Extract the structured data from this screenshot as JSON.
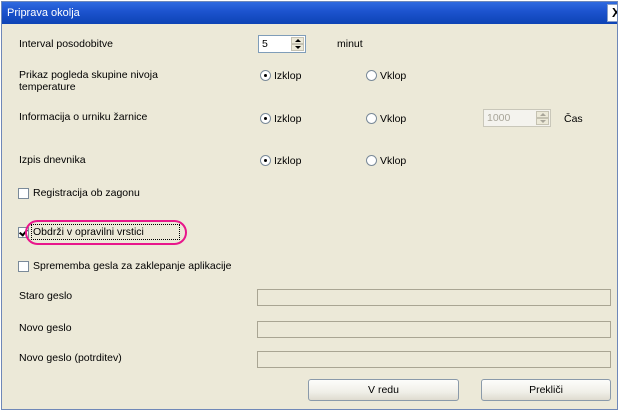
{
  "window": {
    "title": "Priprava okolja"
  },
  "rows": {
    "interval": {
      "label": "Interval posodobitve",
      "value": "5",
      "unit": "minut"
    },
    "group_view": {
      "label_line1": "Prikaz pogleda skupine nivoja",
      "label_line2": "temperature",
      "off_label": "Izklop",
      "on_label": "Vklop",
      "selected": "off"
    },
    "lamp_timer": {
      "label": "Informacija o urniku žarnice",
      "off_label": "Izklop",
      "on_label": "Vklop",
      "selected": "off",
      "time_value": "1000",
      "time_label": "Čas"
    },
    "log_output": {
      "label": "Izpis dnevnika",
      "off_label": "Izklop",
      "on_label": "Vklop",
      "selected": "off"
    }
  },
  "checkboxes": {
    "startup_registration": {
      "label": "Registracija ob zagonu",
      "checked": false
    },
    "keep_in_taskbar": {
      "label": "Obdrži v opravilni vrstici",
      "checked": true
    },
    "password_change": {
      "label": "Sprememba gesla za zaklepanje aplikacije",
      "checked": false
    }
  },
  "passwords": {
    "old": {
      "label": "Staro geslo",
      "value": ""
    },
    "new": {
      "label": "Novo geslo",
      "value": ""
    },
    "confirm": {
      "label": "Novo geslo (potrditev)",
      "value": ""
    }
  },
  "buttons": {
    "ok": "V redu",
    "cancel": "Prekliči"
  },
  "colors": {
    "highlight": "#e8168b",
    "titlebar": "#1d54cf"
  }
}
